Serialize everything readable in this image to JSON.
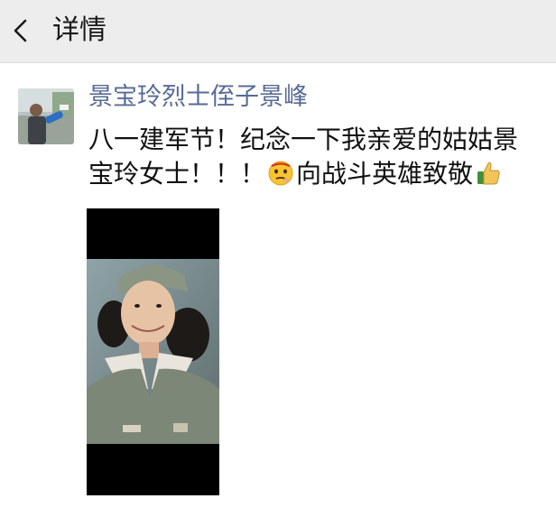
{
  "header": {
    "title": "详情",
    "back_icon": "chevron-left-icon"
  },
  "post": {
    "author": "景宝玲烈士侄子景峰",
    "text_line1": "八一建军节！纪念一下我亲爱的姑姑景",
    "text_line2_part1": "宝玲女士！！！",
    "text_line2_part2": "向战斗英雄致敬",
    "emoji_1": "thinking-face-emoji",
    "emoji_2": "thumbs-up-emoji"
  },
  "colors": {
    "header_bg": "#ededed",
    "author_link": "#576b95",
    "text": "#111111"
  }
}
